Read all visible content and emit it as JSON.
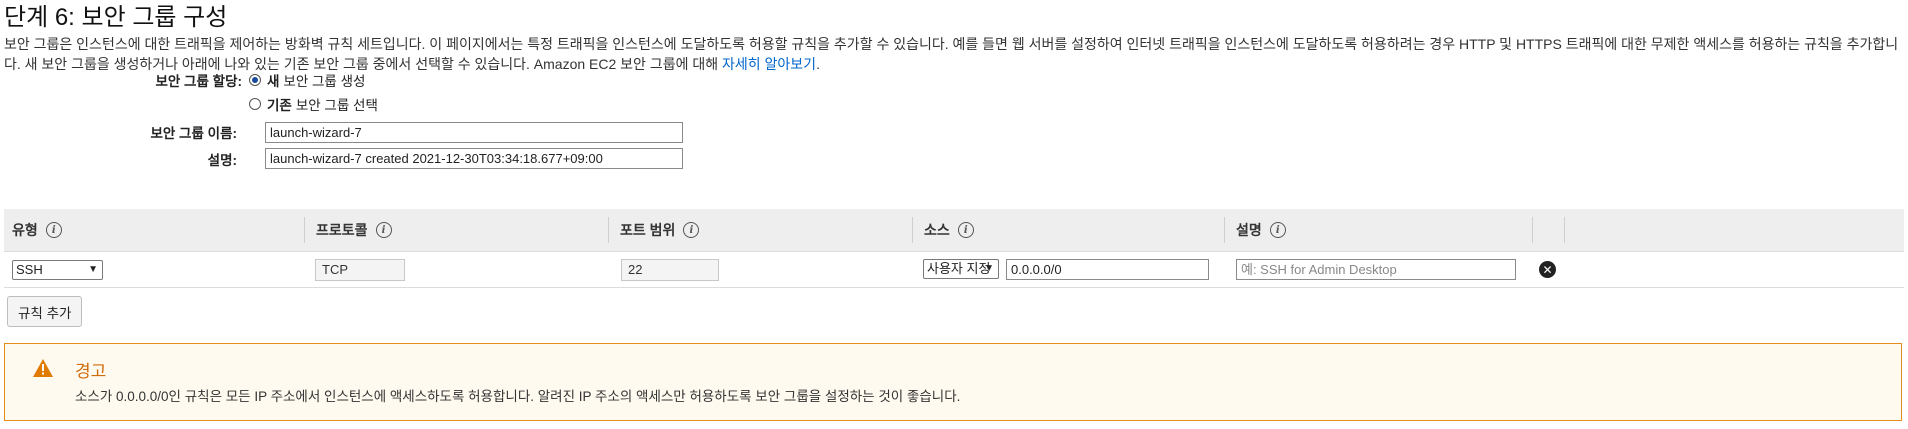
{
  "page": {
    "title": "단계 6: 보안 그룹 구성",
    "intro": "보안 그룹은 인스턴스에 대한 트래픽을 제어하는 방화벽 규칙 세트입니다. 이 페이지에서는 특정 트래픽을 인스턴스에 도달하도록 허용할 규칙을 추가할 수 있습니다. 예를 들면 웹 서버를 설정하여 인터넷 트래픽을 인스턴스에 도달하도록 허용하려는 경우 HTTP 및 HTTPS 트래픽에 대한 무제한 액세스를 허용하는 규칙을 추가합니다. 새 보안 그룹을 생성하거나 아래에 나와 있는 기존 보안 그룹 중에서 선택할 수 있습니다. Amazon EC2 보안 그룹에 대해",
    "learn_more_link": "자세히 알아보기",
    "period": "."
  },
  "assign": {
    "label": "보안 그룹 할당:",
    "option_new_bold": "새",
    "option_new_rest": "보안 그룹 생성",
    "option_existing_bold": "기존",
    "option_existing_rest": "보안 그룹 선택",
    "selected": "new"
  },
  "group_name": {
    "label": "보안 그룹 이름:",
    "value": "launch-wizard-7"
  },
  "group_desc": {
    "label": "설명:",
    "value": "launch-wizard-7 created 2021-12-30T03:34:18.677+09:00"
  },
  "rules_table": {
    "columns": [
      "유형",
      "프로토콜",
      "포트 범위",
      "소스",
      "설명"
    ],
    "info_glyph": "i",
    "rows": [
      {
        "type": "SSH",
        "protocol": "TCP",
        "port_range": "22",
        "source_mode": "사용자 지정",
        "source_cidr": "0.0.0.0/0",
        "description_placeholder": "예: SSH for Admin Desktop"
      }
    ]
  },
  "add_rule_button": "규칙 추가",
  "warning": {
    "title": "경고",
    "message": "소스가 0.0.0.0/0인 규칙은 모든 IP 주소에서 인스턴스에 액세스하도록 허용합니다. 알려진 IP 주소의 액세스만 허용하도록 보안 그룹을 설정하는 것이 좋습니다.",
    "icon": "warning-triangle-icon",
    "color": "#e48d1c"
  },
  "colors": {
    "link": "#0066cc",
    "header_bg": "#eeeeee",
    "warning_title": "#d06c0a"
  }
}
